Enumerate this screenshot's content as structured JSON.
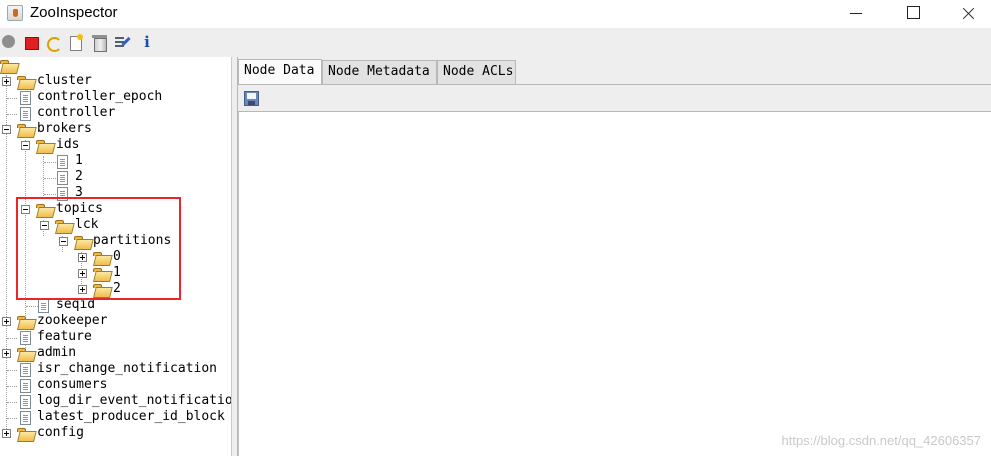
{
  "window": {
    "title": "ZooInspector",
    "app_icon": "java-coffee-cup-icon"
  },
  "toolbar": {
    "buttons": [
      {
        "name": "connect",
        "icon": "connect-circle-icon"
      },
      {
        "name": "disconnect",
        "icon": "stop-square-icon",
        "color": "#e02020"
      },
      {
        "name": "refresh",
        "icon": "refresh-arrows-icon"
      },
      {
        "name": "add-node",
        "icon": "new-node-icon"
      },
      {
        "name": "delete-node",
        "icon": "trash-icon"
      },
      {
        "name": "edit-properties",
        "icon": "edit-list-icon"
      },
      {
        "name": "about",
        "icon": "info-icon",
        "label": "i"
      }
    ]
  },
  "tree": {
    "nodes": [
      {
        "label": "cluster"
      },
      {
        "label": "controller_epoch"
      },
      {
        "label": "controller"
      },
      {
        "label": "brokers"
      },
      {
        "label": "ids"
      },
      {
        "label": "1"
      },
      {
        "label": "2"
      },
      {
        "label": "3"
      },
      {
        "label": "topics"
      },
      {
        "label": "lck"
      },
      {
        "label": "partitions"
      },
      {
        "label": "0"
      },
      {
        "label": "1"
      },
      {
        "label": "2"
      },
      {
        "label": "seqid"
      },
      {
        "label": "zookeeper"
      },
      {
        "label": "feature"
      },
      {
        "label": "admin"
      },
      {
        "label": "isr_change_notification"
      },
      {
        "label": "consumers"
      },
      {
        "label": "log_dir_event_notification"
      },
      {
        "label": "latest_producer_id_block"
      },
      {
        "label": "config"
      }
    ],
    "highlight_color": "#e8262c"
  },
  "tabs": [
    {
      "label": "Node Data",
      "active": true
    },
    {
      "label": "Node Metadata",
      "active": false
    },
    {
      "label": "Node ACLs",
      "active": false
    }
  ],
  "node_data": {
    "save_icon": "floppy-save-icon",
    "content": ""
  },
  "watermark": "https://blog.csdn.net/qq_42606357"
}
